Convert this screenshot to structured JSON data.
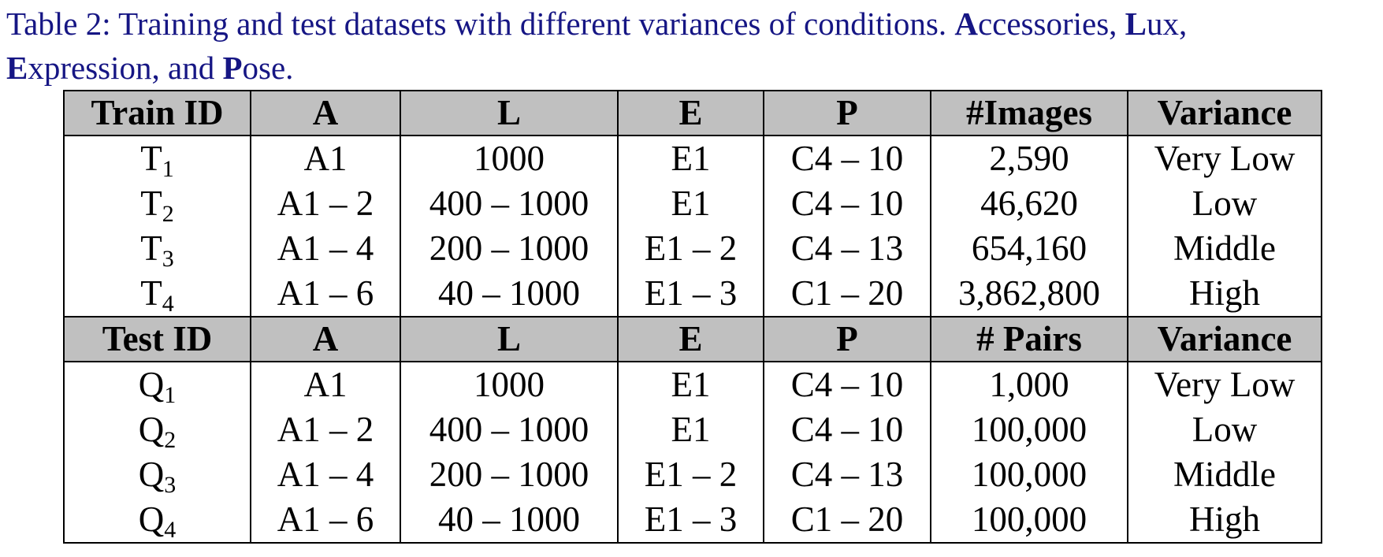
{
  "caption": {
    "prefix": "Table 2: Training and test datasets with different variances of conditions. ",
    "A_bold": "A",
    "A_rest": "ccessories, ",
    "L_bold": "L",
    "L_rest": "ux,",
    "E_bold": "E",
    "E_rest": "xpression, and ",
    "P_bold": "P",
    "P_rest": "ose."
  },
  "train_header": [
    "Train ID",
    "A",
    "L",
    "E",
    "P",
    "#Images",
    "Variance"
  ],
  "train_rows": [
    {
      "id": "T",
      "sub": "1",
      "a": "A1",
      "l": "1000",
      "e": "E1",
      "p": "C4 – 10",
      "n": "2,590",
      "var": "Very Low"
    },
    {
      "id": "T",
      "sub": "2",
      "a": "A1 – 2",
      "l": "400 – 1000",
      "e": "E1",
      "p": "C4 – 10",
      "n": "46,620",
      "var": "Low"
    },
    {
      "id": "T",
      "sub": "3",
      "a": "A1 – 4",
      "l": "200 – 1000",
      "e": "E1 – 2",
      "p": "C4 – 13",
      "n": "654,160",
      "var": "Middle"
    },
    {
      "id": "T",
      "sub": "4",
      "a": "A1 – 6",
      "l": "40 – 1000",
      "e": "E1 – 3",
      "p": "C1 – 20",
      "n": "3,862,800",
      "var": "High"
    }
  ],
  "test_header": [
    "Test ID",
    "A",
    "L",
    "E",
    "P",
    "# Pairs",
    "Variance"
  ],
  "test_rows": [
    {
      "id": "Q",
      "sub": "1",
      "a": "A1",
      "l": "1000",
      "e": "E1",
      "p": "C4 – 10",
      "n": "1,000",
      "var": "Very Low"
    },
    {
      "id": "Q",
      "sub": "2",
      "a": "A1 – 2",
      "l": "400 – 1000",
      "e": "E1",
      "p": "C4 – 10",
      "n": "100,000",
      "var": "Low"
    },
    {
      "id": "Q",
      "sub": "3",
      "a": "A1 – 4",
      "l": "200 – 1000",
      "e": "E1 – 2",
      "p": "C4 – 13",
      "n": "100,000",
      "var": "Middle"
    },
    {
      "id": "Q",
      "sub": "4",
      "a": "A1 – 6",
      "l": "40 – 1000",
      "e": "E1 – 3",
      "p": "C1 – 20",
      "n": "100,000",
      "var": "High"
    }
  ],
  "colors": {
    "caption": "#161684",
    "header_bg": "#c0c0c0",
    "rule": "#000000"
  }
}
